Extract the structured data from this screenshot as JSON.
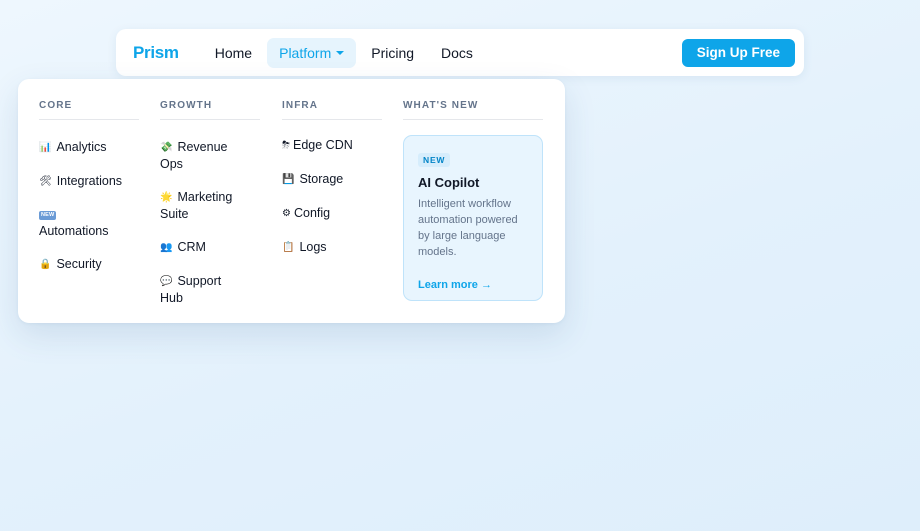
{
  "nav": {
    "brand": "Prism",
    "items": [
      {
        "label": "Home"
      },
      {
        "label": "Platform"
      },
      {
        "label": "Pricing"
      },
      {
        "label": "Docs"
      }
    ],
    "cta_label": "Sign Up Free"
  },
  "menu": {
    "columns": [
      {
        "title": "CORE",
        "items": [
          {
            "icon": "📊",
            "icon_name": "bar-chart-icon",
            "label": "Analytics"
          },
          {
            "icon": "🛠",
            "icon_name": "tools-icon",
            "label": "Integrations"
          },
          {
            "icon": "NEW",
            "icon_name": "new-badge-icon",
            "label": "Automations"
          },
          {
            "icon": "🔒",
            "icon_name": "lock-icon",
            "label": "Security"
          }
        ]
      },
      {
        "title": "GROWTH",
        "items": [
          {
            "icon": "💸",
            "icon_name": "money-icon",
            "label": "Revenue Ops"
          },
          {
            "icon": "🌟",
            "icon_name": "star-icon",
            "label": "Marketing Suite"
          },
          {
            "icon": "👥",
            "icon_name": "people-icon",
            "label": "CRM"
          },
          {
            "icon": "💬",
            "icon_name": "chat-icon",
            "label": "Support Hub"
          }
        ]
      },
      {
        "title": "INFRA",
        "items": [
          {
            "icon": "⛈",
            "icon_name": "cloud-icon",
            "label": "Edge CDN"
          },
          {
            "icon": "💾",
            "icon_name": "disk-icon",
            "label": "Storage"
          },
          {
            "icon": "⚙",
            "icon_name": "gear-icon",
            "label": "Config"
          },
          {
            "icon": "📋",
            "icon_name": "clipboard-icon",
            "label": "Logs"
          }
        ]
      },
      {
        "title": "WHAT'S NEW"
      }
    ],
    "feature": {
      "badge": "NEW",
      "title": "AI Copilot",
      "description": "Intelligent workflow automation powered by large language models.",
      "link": "Learn more →"
    }
  },
  "colors": {
    "accent": "#0ea5e9",
    "text": "#111827",
    "muted": "#64748b",
    "feature_bg": "#e8f5fe"
  }
}
